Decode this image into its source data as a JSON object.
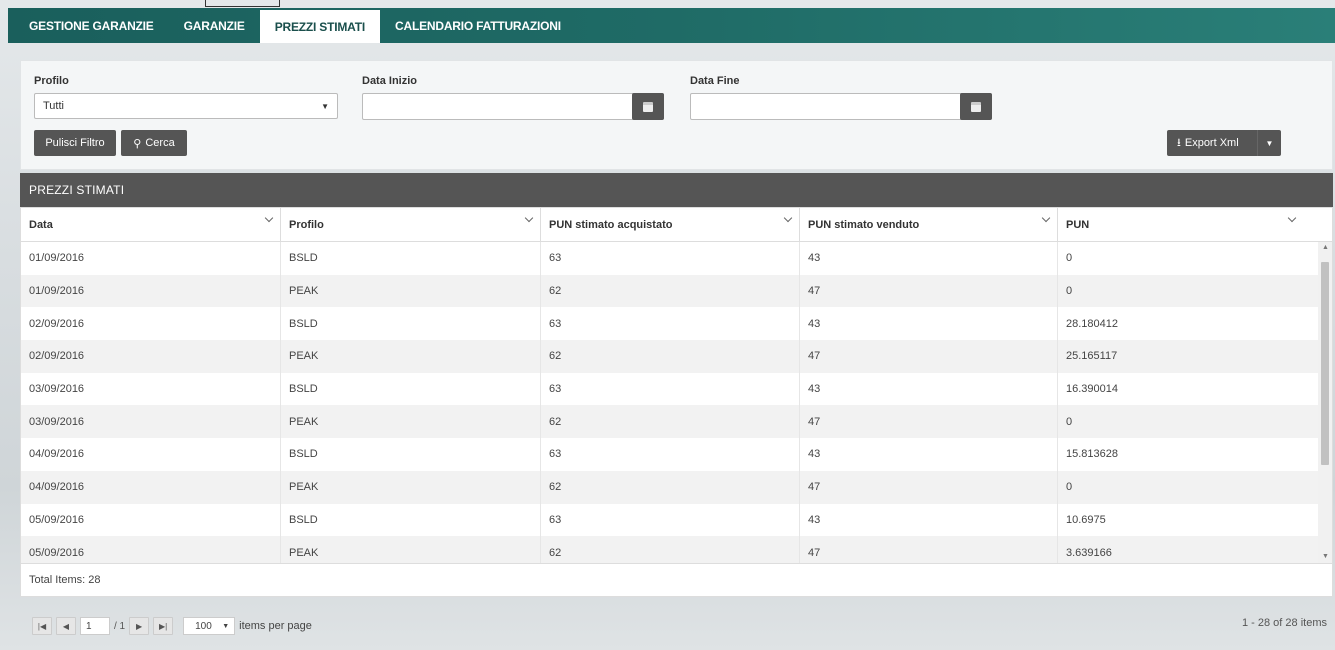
{
  "nav": {
    "tabs": [
      {
        "label": "GESTIONE GARANZIE",
        "active": false
      },
      {
        "label": "GARANZIE",
        "active": false
      },
      {
        "label": "PREZZI STIMATI",
        "active": true
      },
      {
        "label": "CALENDARIO FATTURAZIONI",
        "active": false
      }
    ]
  },
  "filters": {
    "profilo_label": "Profilo",
    "profilo_value": "Tutti",
    "data_inizio_label": "Data Inizio",
    "data_inizio_value": "",
    "data_fine_label": "Data Fine",
    "data_fine_value": "",
    "clear_label": "Pulisci Filtro",
    "search_label": "Cerca",
    "export_label": "Export Xml"
  },
  "grid": {
    "title": "PREZZI STIMATI",
    "columns": [
      "Data",
      "Profilo",
      "PUN stimato acquistato",
      "PUN stimato venduto",
      "PUN"
    ],
    "rows": [
      [
        "01/09/2016",
        "BSLD",
        "63",
        "43",
        "0"
      ],
      [
        "01/09/2016",
        "PEAK",
        "62",
        "47",
        "0"
      ],
      [
        "02/09/2016",
        "BSLD",
        "63",
        "43",
        "28.180412"
      ],
      [
        "02/09/2016",
        "PEAK",
        "62",
        "47",
        "25.165117"
      ],
      [
        "03/09/2016",
        "BSLD",
        "63",
        "43",
        "16.390014"
      ],
      [
        "03/09/2016",
        "PEAK",
        "62",
        "47",
        "0"
      ],
      [
        "04/09/2016",
        "BSLD",
        "63",
        "43",
        "15.813628"
      ],
      [
        "04/09/2016",
        "PEAK",
        "62",
        "47",
        "0"
      ],
      [
        "05/09/2016",
        "BSLD",
        "63",
        "43",
        "10.6975"
      ],
      [
        "05/09/2016",
        "PEAK",
        "62",
        "47",
        "3.639166"
      ]
    ],
    "total_label": "Total Items: 28"
  },
  "pager": {
    "page": "1",
    "total_pages_text": "/ 1",
    "page_size": "100",
    "per_page_label": "items per page",
    "info": "1 - 28 of 28 items"
  }
}
